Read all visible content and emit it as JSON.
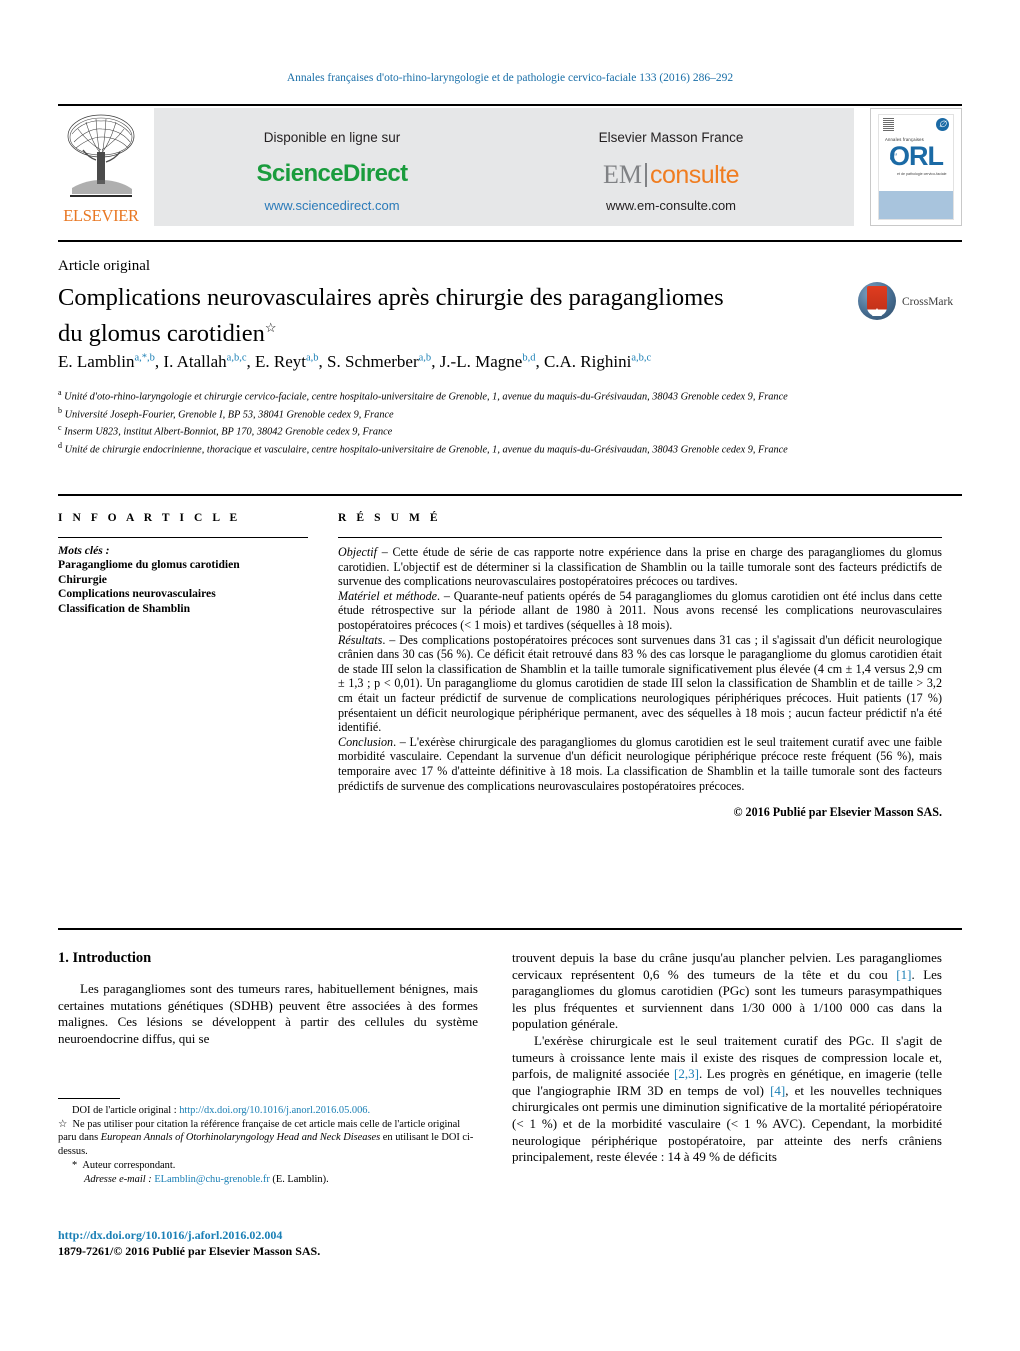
{
  "running_head": "Annales françaises d'oto-rhino-laryngologie et de pathologie cervico-faciale 133 (2016) 286–292",
  "banner": {
    "elsevier_wordmark": "ELSEVIER",
    "sciencedirect": {
      "top_label": "Disponible en ligne sur",
      "brand": "ScienceDirect",
      "url": "www.sciencedirect.com"
    },
    "emconsulte": {
      "top_label": "Elsevier Masson France",
      "brand_part1": "EM",
      "brand_part2": "consulte",
      "url": "www.em-consulte.com"
    },
    "cover": {
      "badge_glyph": "∅",
      "small_line": "Annales françaises",
      "title": "ORL",
      "prefix": "d'",
      "strap": "et de pathologie cervico-faciale"
    }
  },
  "article": {
    "type": "Article original",
    "title_line1": "Complications neurovasculaires après chirurgie des paragangliomes",
    "title_line2": "du glomus carotidien",
    "title_marker": "☆",
    "crossmark_label": "CrossMark",
    "authors": [
      {
        "name": "E. Lamblin",
        "sup": "a,*,b"
      },
      {
        "name": "I. Atallah",
        "sup": "a,b,c"
      },
      {
        "name": "E. Reyt",
        "sup": "a,b"
      },
      {
        "name": "S. Schmerber",
        "sup": "a,b"
      },
      {
        "name": "J.-L. Magne",
        "sup": "b,d"
      },
      {
        "name": "C.A. Righini",
        "sup": "a,b,c"
      }
    ],
    "affiliations": [
      {
        "mark": "a",
        "text": "Unité d'oto-rhino-laryngologie et chirurgie cervico-faciale, centre hospitalo-universitaire de Grenoble, 1, avenue du maquis-du-Grésivaudan, 38043 Grenoble cedex 9, France"
      },
      {
        "mark": "b",
        "text": "Université Joseph-Fourier, Grenoble I, BP 53, 38041 Grenoble cedex 9, France"
      },
      {
        "mark": "c",
        "text": "Inserm U823, institut Albert-Bonniot, BP 170, 38042 Grenoble cedex 9, France"
      },
      {
        "mark": "d",
        "text": "Unité de chirurgie endocrinienne, thoracique et vasculaire, centre hospitalo-universitaire de Grenoble, 1, avenue du maquis-du-Grésivaudan, 38043 Grenoble cedex 9, France"
      }
    ]
  },
  "info_article": {
    "heading": "I N F O   A R T I C L E",
    "keywords_label": "Mots clés :",
    "keywords": [
      "Paragangliome du glomus carotidien",
      "Chirurgie",
      "Complications neurovasculaires",
      "Classification de Shamblin"
    ]
  },
  "resume": {
    "heading": "R É S U M É",
    "objectif_label": "Objectif",
    "objectif_text": " – Cette étude de série de cas rapporte notre expérience dans la prise en charge des paragangliomes du glomus carotidien. L'objectif est de déterminer si la classification de Shamblin ou la taille tumorale sont des facteurs prédictifs de survenue des complications neurovasculaires postopératoires précoces ou tardives.",
    "materiel_label": "Matériel et méthode",
    "materiel_text": ". – Quarante-neuf patients opérés de 54 paragangliomes du glomus carotidien ont été inclus dans cette étude rétrospective sur la période allant de 1980 à 2011. Nous avons recensé les complications neurovasculaires postopératoires précoces (< 1 mois) et tardives (séquelles à 18 mois).",
    "resultats_label": "Résultats",
    "resultats_text": ". – Des complications postopératoires précoces sont survenues dans 31 cas ; il s'agissait d'un déficit neurologique crânien dans 30 cas (56 %). Ce déficit était retrouvé dans 83 % des cas lorsque le paragangliome du glomus carotidien était de stade III selon la classification de Shamblin et la taille tumorale significativement plus élevée (4 cm ± 1,4 versus 2,9 cm ± 1,3 ; p < 0,01). Un paragangliome du glomus carotidien de stade III selon la classification de Shamblin et de taille > 3,2 cm était un facteur prédictif de survenue de complications neurologiques périphériques précoces. Huit patients (17 %) présentaient un déficit neurologique périphérique permanent, avec des séquelles à 18 mois ; aucun facteur prédictif n'a été identifié.",
    "conclusion_label": "Conclusion",
    "conclusion_text": ". – L'exérèse chirurgicale des paragangliomes du glomus carotidien est le seul traitement curatif avec une faible morbidité vasculaire. Cependant la survenue d'un déficit neurologique périphérique précoce reste fréquent (56 %), mais temporaire avec 17 % d'atteinte définitive à 18 mois. La classification de Shamblin et la taille tumorale sont des facteurs prédictifs de survenue des complications neurovasculaires postopératoires précoces.",
    "copyright": "© 2016 Publié par Elsevier Masson SAS."
  },
  "introduction": {
    "heading": "1.  Introduction",
    "left_p1": "Les paragangliomes sont des tumeurs rares, habituellement bénignes, mais certaines mutations génétiques (SDHB) peuvent être associées à des formes malignes. Ces lésions se développent à partir des cellules du système neuroendocrine diffus, qui se",
    "right_p1_a": "trouvent depuis la base du crâne jusqu'au plancher pelvien. Les paragangliomes cervicaux représentent 0,6 % des tumeurs de la tête et du cou ",
    "right_p1_ref": "[1]",
    "right_p1_b": ". Les paragangliomes du glomus carotidien (PGc) sont les tumeurs parasympathiques les plus fréquentes et surviennent dans 1/30 000 à 1/100 000 cas dans la population générale.",
    "right_p2_a": "L'exérèse chirurgicale est le seul traitement curatif des PGc. Il s'agit de tumeurs à croissance lente mais il existe des risques de compression locale et, parfois, de malignité associée ",
    "right_p2_ref1": "[2,3]",
    "right_p2_b": ". Les progrès en génétique, en imagerie (telle que l'angiographie IRM 3D en temps de vol) ",
    "right_p2_ref2": "[4]",
    "right_p2_c": ", et les nouvelles techniques chirurgicales ont permis une diminution significative de la mortalité périopératoire (< 1 %) et de la morbidité vasculaire (< 1 % AVC). Cependant, la morbidité neurologique périphérique postopératoire, par atteinte des nerfs crâniens principalement, reste élevée : 14 à 49 % de déficits"
  },
  "footnotes": {
    "doi_label": "DOI de l'article original : ",
    "doi_link": "http://dx.doi.org/10.1016/j.anorl.2016.05.006.",
    "star_symbol": "☆",
    "star_text_a": "Ne pas utiliser pour citation la référence française de cet article mais celle de l'article original paru dans ",
    "star_journal": "European Annals of Otorhinolaryngology Head and Neck Diseases",
    "star_text_b": " en utilisant le DOI ci-dessus.",
    "corr_symbol": "*",
    "corr_text": "Auteur correspondant.",
    "email_label": "Adresse e-mail :",
    "email": "ELamblin@chu-grenoble.fr",
    "email_owner": "(E. Lamblin)."
  },
  "footer": {
    "doi": "http://dx.doi.org/10.1016/j.aforl.2016.02.004",
    "issn_line": "1879-7261/© 2016 Publié par Elsevier Masson SAS."
  },
  "colors": {
    "link_blue": "#1a7fb5",
    "runhead_blue": "#1a6fa8",
    "sciencedirect_green": "#1a9c3d",
    "elsevier_orange": "#e87722",
    "emconsulte_orange": "#f07d20",
    "banner_grey": "#e6e7e8"
  }
}
